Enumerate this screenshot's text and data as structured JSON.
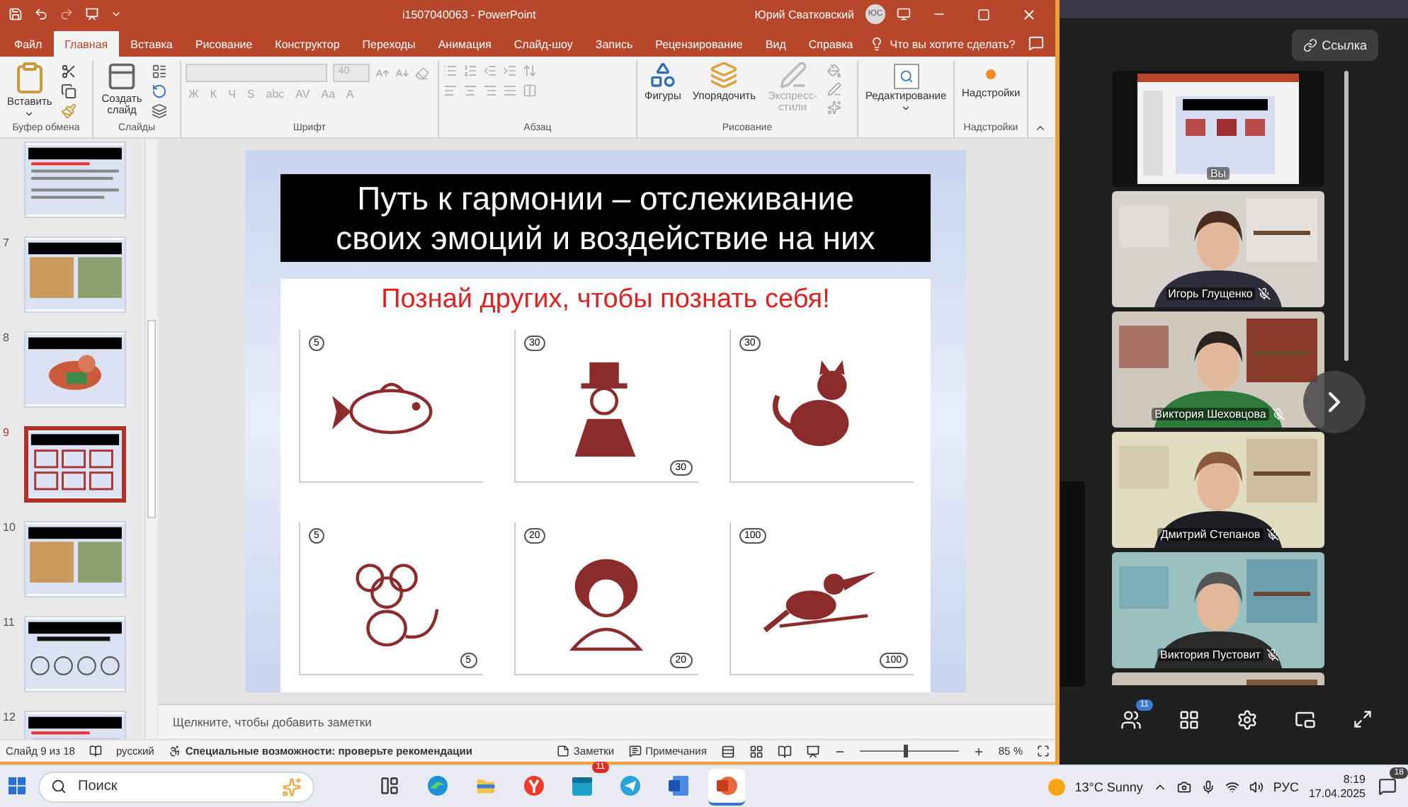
{
  "title_bar": {
    "document": "i1507040063 - PowerPoint",
    "user": "Юрий Сватковский",
    "avatar": "ЮС"
  },
  "tabs": [
    {
      "label": "Файл",
      "selected": false
    },
    {
      "label": "Главная",
      "selected": true
    },
    {
      "label": "Вставка",
      "selected": false
    },
    {
      "label": "Рисование",
      "selected": false
    },
    {
      "label": "Конструктор",
      "selected": false
    },
    {
      "label": "Переходы",
      "selected": false
    },
    {
      "label": "Анимация",
      "selected": false
    },
    {
      "label": "Слайд-шоу",
      "selected": false
    },
    {
      "label": "Запись",
      "selected": false
    },
    {
      "label": "Рецензирование",
      "selected": false
    },
    {
      "label": "Вид",
      "selected": false
    },
    {
      "label": "Справка",
      "selected": false
    }
  ],
  "tell_me": "Что вы хотите сделать?",
  "ribbon": [
    {
      "kind": "clipboard",
      "label": "Буфер обмена",
      "button": "Вставить"
    },
    {
      "kind": "slides",
      "label": "Слайды",
      "button": "Создать слайд"
    },
    {
      "kind": "font",
      "label": "Шрифт",
      "disabled": true,
      "size": "40",
      "format": [
        "Ж",
        "К",
        "Ч",
        "S",
        "abc",
        "AV",
        "Aa",
        "A"
      ]
    },
    {
      "kind": "paragraph",
      "label": "Абзац",
      "disabled": true
    },
    {
      "kind": "drawing",
      "label": "Рисование",
      "buttons": [
        {
          "label": "Фигуры",
          "disabled": false
        },
        {
          "label": "Упорядочить",
          "disabled": false
        },
        {
          "label": "Экспресс-стили",
          "disabled": true
        }
      ]
    },
    {
      "kind": "editing",
      "button": "Редактирование"
    },
    {
      "kind": "addins",
      "label": "Надстройки",
      "button": "Надстройки"
    }
  ],
  "thumbnails": [
    {
      "kind": "text",
      "selected": false
    },
    {
      "number": "7",
      "kind": "pictures",
      "selected": false
    },
    {
      "number": "8",
      "kind": "cartoon",
      "selected": false
    },
    {
      "number": "9",
      "kind": "grid",
      "selected": true
    },
    {
      "number": "10",
      "kind": "pictures",
      "selected": false
    },
    {
      "number": "11",
      "kind": "faces",
      "selected": false
    },
    {
      "number": "12",
      "kind": "text",
      "selected": false
    }
  ],
  "slide": {
    "title": "Путь к гармонии – отслеживание своих эмоций и воздействие на них",
    "subtitle": "Познай других, чтобы познать себя!",
    "cards": [
      {
        "kind": "fish",
        "marks": [
          "5"
        ]
      },
      {
        "kind": "man-in-hat",
        "marks": [
          "30",
          "30"
        ]
      },
      {
        "kind": "cat",
        "marks": [
          "30"
        ]
      },
      {
        "kind": "mouse",
        "marks": [
          "5",
          "5"
        ]
      },
      {
        "kind": "woman",
        "marks": [
          "20",
          "20"
        ]
      },
      {
        "kind": "bird",
        "marks": [
          "100",
          "100"
        ]
      }
    ]
  },
  "notes_placeholder": "Щелкните, чтобы добавить заметки",
  "status_bar": {
    "slide": "Слайд 9 из 18",
    "language": "русский",
    "accessibility": "Специальные возможности: проверьте рекомендации",
    "notes": "Заметки",
    "comments": "Примечания",
    "zoom": "85 %",
    "zoom_slider": {
      "level": 0.45
    }
  },
  "meeting": {
    "link_button": "Ссылка",
    "participants_badge": "11",
    "tiles": [
      {
        "kind": "screen",
        "name": "Вы"
      },
      {
        "kind": "camera",
        "name": "Игорь Глущенко",
        "muted": true
      },
      {
        "kind": "camera",
        "name": "Виктория Шеховцова",
        "muted": true
      },
      {
        "kind": "camera",
        "name": "Дмитрий Степанов",
        "muted": true
      },
      {
        "kind": "camera",
        "name": "Виктория Пустовит",
        "muted": true
      },
      {
        "kind": "camera"
      }
    ]
  },
  "taskbar": {
    "search_placeholder": "Поиск",
    "apps": [
      {
        "kind": "task-view",
        "selected": false
      },
      {
        "kind": "browser",
        "selected": false
      },
      {
        "kind": "folder",
        "selected": false
      },
      {
        "kind": "logo",
        "selected": false
      },
      {
        "kind": "calendar",
        "badge": "11",
        "selected": false
      },
      {
        "kind": "messenger",
        "selected": false
      },
      {
        "kind": "document",
        "selected": false
      },
      {
        "kind": "presentation",
        "selected": true
      }
    ],
    "weather": "13°C Sunny",
    "language": "РУС",
    "time": "8:19",
    "date": "17.04.2025",
    "notifications": "18"
  }
}
